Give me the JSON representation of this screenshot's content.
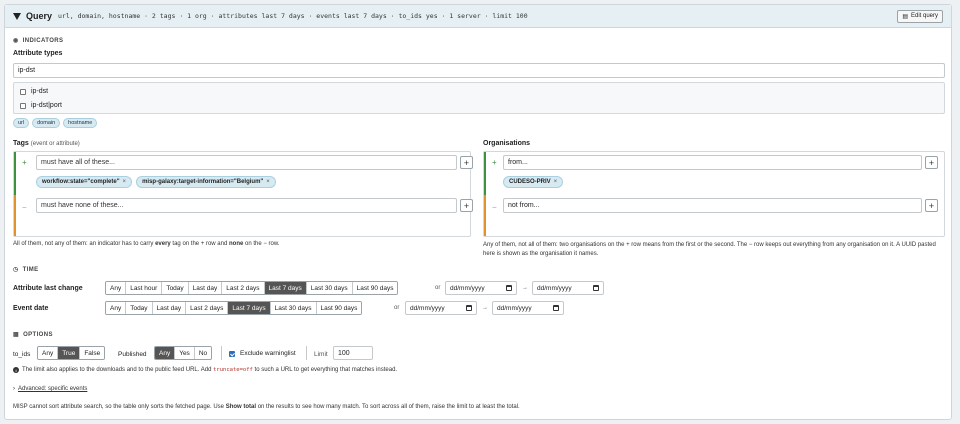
{
  "header": {
    "title": "Query",
    "summary": "url, domain, hostname · 2 tags · 1 org · attributes last 7 days · events last 7 days · to_ids yes · 1 server · limit 100",
    "edit_label": "Edit query"
  },
  "indicators": {
    "section_title": "INDICATORS",
    "attr_types_label": "Attribute types",
    "search_value": "ip-dst",
    "options": [
      "ip-dst",
      "ip-dst|port"
    ],
    "selected_types": [
      "url",
      "domain",
      "hostname"
    ]
  },
  "tags": {
    "label": "Tags",
    "sublabel": "(event or attribute)",
    "must_have_placeholder": "must have all of these...",
    "must_have": [
      "workflow:state=\"complete\"",
      "misp-galaxy:target-information=\"Belgium\""
    ],
    "none_placeholder": "must have none of these...",
    "plus_sign": "+",
    "minus_sign": "−",
    "note_pre": "All of them, not any of them: an indicator has to carry ",
    "note_every": "every",
    "note_mid": " tag on the + row and ",
    "note_none": "none",
    "note_post": " on the − row."
  },
  "orgs": {
    "label": "Organisations",
    "from_placeholder": "from...",
    "from": [
      "CUDESO-PRIV"
    ],
    "not_from_placeholder": "not from...",
    "plus_sign": "+",
    "minus_sign": "−",
    "note": "Any of them, not all of them: two organisations on the + row means from the first or the second. The − row keeps out everything from any organisation on it. A UUID pasted here is shown as the organisation it names."
  },
  "time": {
    "section_title": "TIME",
    "attr_label": "Attribute last change",
    "attr_options": [
      "Any",
      "Last hour",
      "Today",
      "Last day",
      "Last 2 days",
      "Last 7 days",
      "Last 30 days",
      "Last 90 days"
    ],
    "attr_selected": "Last 7 days",
    "event_label": "Event date",
    "event_options": [
      "Any",
      "Today",
      "Last day",
      "Last 2 days",
      "Last 7 days",
      "Last 30 days",
      "Last 90 days"
    ],
    "event_selected": "Last 7 days",
    "or_label": "or",
    "arrow": "→",
    "date_placeholder": "dd/mm/yyyy"
  },
  "options": {
    "section_title": "OPTIONS",
    "to_ids_label": "to_ids",
    "to_ids_options": [
      "Any",
      "True",
      "False"
    ],
    "to_ids_selected": "True",
    "published_label": "Published",
    "published_options": [
      "Any",
      "Yes",
      "No"
    ],
    "published_selected": "Any",
    "exclude_label": "Exclude warninglist",
    "limit_label": "Limit",
    "limit_value": "100",
    "info_pre": "The limit also applies to the downloads and to the public feed URL. Add ",
    "info_code": "truncate=off",
    "info_post": " to such a URL to get everything that matches instead.",
    "advanced_label": "Advanced: specific events",
    "footer_pre": "MISP cannot sort attribute search, so the table only sorts the fetched page. Use ",
    "footer_bold": "Show total",
    "footer_post": " on the results to see how many match. To sort across all of them, raise the limit to at least the total."
  },
  "colors": {
    "plus": "#3f9142",
    "minus": "#e0922f",
    "header_bg": "#e6f0f4",
    "chip_bg": "#d7eaf2"
  }
}
